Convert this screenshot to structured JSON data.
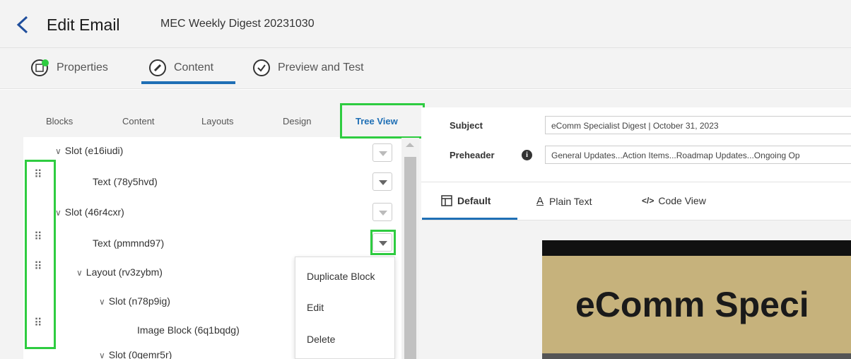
{
  "header": {
    "title": "Edit Email",
    "subtitle": "MEC Weekly Digest 20231030"
  },
  "steps": [
    {
      "label": "Properties"
    },
    {
      "label": "Content"
    },
    {
      "label": "Preview and Test"
    }
  ],
  "left_tabs": [
    "Blocks",
    "Content",
    "Layouts",
    "Design",
    "Tree View"
  ],
  "tree": [
    {
      "label": "Slot (e16iudi)"
    },
    {
      "label": "Text (78y5hvd)"
    },
    {
      "label": "Slot (46r4cxr)"
    },
    {
      "label": "Text (pmmnd97)"
    },
    {
      "label": "Layout (rv3zybm)"
    },
    {
      "label": "Slot (n78p9ig)"
    },
    {
      "label": "Image Block (6q1bqdg)"
    },
    {
      "label": "Slot (0gemr5r)"
    }
  ],
  "context_menu": [
    "Duplicate Block",
    "Edit",
    "Delete"
  ],
  "meta": {
    "subject_label": "Subject",
    "subject_value": "eComm Specialist Digest | October 31, 2023",
    "preheader_label": "Preheader",
    "preheader_value": "General Updates...Action Items...Roadmap Updates...Ongoing Op"
  },
  "view_tabs": [
    "Default",
    "Plain Text",
    "Code View"
  ],
  "email_preview": {
    "heading": "eComm Speci"
  },
  "colors": {
    "accent": "#1f6fb5",
    "highlight": "#2ecc40",
    "email_gold": "#c6b27c"
  }
}
